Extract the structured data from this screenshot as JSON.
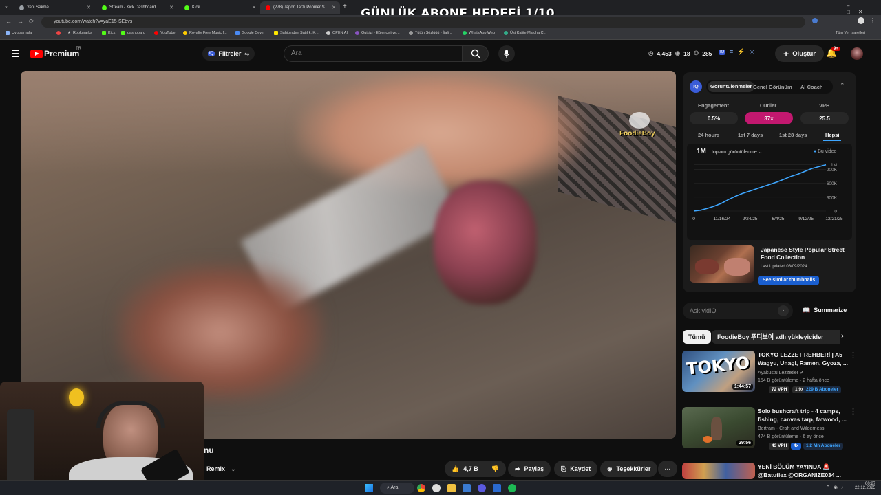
{
  "overlay": {
    "title": "GÜNLÜK ABONE HEDEFİ 1/10"
  },
  "browser": {
    "tabs": [
      {
        "label": "Yeni Sekme",
        "color": "#9aa0a6"
      },
      {
        "label": "Stream - Kick Dashboard",
        "color": "#53fc18"
      },
      {
        "label": "Kick",
        "color": "#53fc18"
      },
      {
        "label": "(278) Japon Tarzı Popüler S",
        "color": "#ff0000"
      }
    ],
    "url": "youtube.com/watch?v=yaE15-SEbvs",
    "bookmarks": [
      "Uygulamalar",
      "Rookmarks",
      "Kick",
      "dashboard",
      "YouTube",
      "Royalty Free Music f...",
      "Google Çeviri",
      "Sahibinden Satılık, K...",
      "OPEN AI",
      "Quizizi - Eğlenceli ve...",
      "Tütün Sözlüğü - İtali...",
      "WhatsApp Web",
      "Üst Kalite Matcha Ç..."
    ],
    "all_bookmarks": "Tüm Yer İşaretleri"
  },
  "yt": {
    "logo": "Premium",
    "logo_sup": "TR",
    "filters": "Filtreler",
    "search_placeholder": "Ara",
    "stats": {
      "a": "4,453",
      "b": "18",
      "c": "285"
    },
    "create": "Oluştur",
    "notif": "9+"
  },
  "iq": {
    "tabs": [
      "Görüntülenmeler",
      "Genel Görünüm",
      "AI Coach"
    ],
    "metrics": [
      {
        "label": "Engagement",
        "value": "0.5%"
      },
      {
        "label": "Outlier",
        "value": "37x"
      },
      {
        "label": "VPH",
        "value": "25.5"
      }
    ],
    "ranges": [
      "24 hours",
      "1st 7 days",
      "1st 28 days",
      "Hepsi"
    ],
    "big": "1M",
    "dropdown": "toplam görüntülenme",
    "legend": "Bu video",
    "promo_title": "Japanese Style Popular Street Food Collection",
    "promo_date": "Last Updated 08/09/2024",
    "promo_btn": "See similar thumbnails",
    "ask": "Ask vidIQ",
    "summarize": "Summarize"
  },
  "chart_data": {
    "type": "line",
    "x": [
      "11/16/24",
      "2/24/25",
      "6/4/25",
      "9/12/25",
      "12/21/25"
    ],
    "y_ticks": [
      "1M",
      "900K",
      "600K",
      "300K",
      "0"
    ],
    "x_ticks": [
      "0",
      "11/16/24",
      "2/24/25",
      "6/4/25",
      "9/12/25",
      "12/21/25"
    ],
    "series": [
      {
        "name": "Bu video",
        "values": [
          0,
          20000,
          60000,
          110000,
          170000,
          250000,
          320000,
          380000,
          430000,
          480000,
          530000,
          580000,
          630000,
          690000,
          750000,
          800000,
          860000,
          920000,
          960000,
          1000000
        ]
      }
    ],
    "ylim": [
      0,
      1100000
    ]
  },
  "chips": [
    "Tümü",
    "FoodieBoy 푸디보이 adlı yükleyiciden"
  ],
  "recs": [
    {
      "title": "TOKYO LEZZET REHBERİ | A5 Wagyu, Unagi, Ramen, Gyoza, ...",
      "channel": "Ayaküstü Lezzetler",
      "meta": "154 B görüntüleme · 2 hafta önce",
      "dur": "1:44:57",
      "vph": "72 VPH",
      "x": "1.9x",
      "subs": "229 B Aboneler"
    },
    {
      "title": "Solo bushcraft trip - 4 camps, fishing, canvas tarp, fatwood, ...",
      "channel": "Bertram - Craft and Wilderness",
      "meta": "474 B görüntüleme · 6 ay önce",
      "dur": "29:56",
      "vph": "43 VPH",
      "x": "4x",
      "subs": "1,2 Mn Aboneler"
    },
    {
      "title": "YENİ BÖLÜM YAYINDA 🚨 @Batuflex @ORGANIZE034 ...",
      "channel": "",
      "meta": "",
      "dur": "",
      "vph": "",
      "x": "",
      "subs": ""
    }
  ],
  "video": {
    "title_frag": "nu",
    "remix": "Remix",
    "likes": "4,7 B",
    "share": "Paylaş",
    "save": "Kaydet",
    "thanks": "Teşekkürler",
    "watermark": "FoodieBoy"
  },
  "taskbar": {
    "search": "Ara",
    "time": "00:27",
    "date": "22.12.2025"
  }
}
